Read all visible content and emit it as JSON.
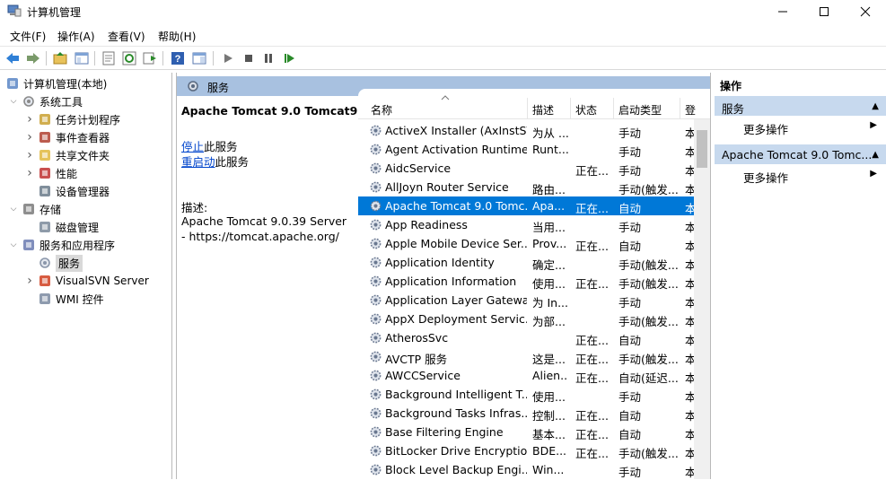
{
  "window": {
    "title": "计算机管理"
  },
  "menu": [
    "文件(F)",
    "操作(A)",
    "查看(V)",
    "帮助(H)"
  ],
  "tree": [
    {
      "label": "计算机管理(本地)",
      "level": 0,
      "expander": "",
      "icon": "computer-management-icon"
    },
    {
      "label": "系统工具",
      "level": 1,
      "expander": "v",
      "icon": "tools-icon"
    },
    {
      "label": "任务计划程序",
      "level": 2,
      "expander": ">",
      "icon": "task-scheduler-icon"
    },
    {
      "label": "事件查看器",
      "level": 2,
      "expander": ">",
      "icon": "event-viewer-icon"
    },
    {
      "label": "共享文件夹",
      "level": 2,
      "expander": ">",
      "icon": "shared-folder-icon"
    },
    {
      "label": "性能",
      "level": 2,
      "expander": ">",
      "icon": "performance-icon"
    },
    {
      "label": "设备管理器",
      "level": 2,
      "expander": "",
      "icon": "device-manager-icon"
    },
    {
      "label": "存储",
      "level": 1,
      "expander": "v",
      "icon": "storage-icon"
    },
    {
      "label": "磁盘管理",
      "level": 2,
      "expander": "",
      "icon": "disk-management-icon"
    },
    {
      "label": "服务和应用程序",
      "level": 1,
      "expander": "v",
      "icon": "services-apps-icon"
    },
    {
      "label": "服务",
      "level": 2,
      "expander": "",
      "icon": "services-icon",
      "selected": true
    },
    {
      "label": "VisualSVN Server",
      "level": 2,
      "expander": ">",
      "icon": "visualsvn-icon"
    },
    {
      "label": "WMI 控件",
      "level": 2,
      "expander": "",
      "icon": "wmi-icon"
    }
  ],
  "middle": {
    "header": "服务",
    "selected_service": "Apache Tomcat 9.0 Tomcat9",
    "stop_link": "停止",
    "stop_suffix": "此服务",
    "restart_link": "重启动",
    "restart_suffix": "此服务",
    "desc_label": "描述:",
    "desc_text": "Apache Tomcat 9.0.39 Server - https://tomcat.apache.org/"
  },
  "columns": [
    "名称",
    "描述",
    "状态",
    "启动类型",
    "登"
  ],
  "services": [
    {
      "name": "ActiveX Installer (AxInstSV)",
      "desc": "为从 ...",
      "status": "",
      "startup": "手动",
      "logon": "本"
    },
    {
      "name": "Agent Activation Runtime...",
      "desc": "Runt...",
      "status": "",
      "startup": "手动",
      "logon": "本"
    },
    {
      "name": "AidcService",
      "desc": "",
      "status": "正在...",
      "startup": "手动",
      "logon": "本"
    },
    {
      "name": "AllJoyn Router Service",
      "desc": "路由...",
      "status": "",
      "startup": "手动(触发...",
      "logon": "本"
    },
    {
      "name": "Apache Tomcat 9.0 Tomc...",
      "desc": "Apa...",
      "status": "正在...",
      "startup": "自动",
      "logon": "本",
      "selected": true
    },
    {
      "name": "App Readiness",
      "desc": "当用...",
      "status": "",
      "startup": "手动",
      "logon": "本"
    },
    {
      "name": "Apple Mobile Device Ser...",
      "desc": "Prov...",
      "status": "正在...",
      "startup": "自动",
      "logon": "本"
    },
    {
      "name": "Application Identity",
      "desc": "确定...",
      "status": "",
      "startup": "手动(触发...",
      "logon": "本"
    },
    {
      "name": "Application Information",
      "desc": "使用...",
      "status": "正在...",
      "startup": "手动(触发...",
      "logon": "本"
    },
    {
      "name": "Application Layer Gatewa...",
      "desc": "为 In...",
      "status": "",
      "startup": "手动",
      "logon": "本"
    },
    {
      "name": "AppX Deployment Servic...",
      "desc": "为部...",
      "status": "",
      "startup": "手动(触发...",
      "logon": "本"
    },
    {
      "name": "AtherosSvc",
      "desc": "",
      "status": "正在...",
      "startup": "自动",
      "logon": "本"
    },
    {
      "name": "AVCTP 服务",
      "desc": "这是...",
      "status": "正在...",
      "startup": "手动(触发...",
      "logon": "本"
    },
    {
      "name": "AWCCService",
      "desc": "Alien...",
      "status": "正在...",
      "startup": "自动(延迟...",
      "logon": "本"
    },
    {
      "name": "Background Intelligent T...",
      "desc": "使用...",
      "status": "",
      "startup": "手动",
      "logon": "本"
    },
    {
      "name": "Background Tasks Infras...",
      "desc": "控制...",
      "status": "正在...",
      "startup": "自动",
      "logon": "本"
    },
    {
      "name": "Base Filtering Engine",
      "desc": "基本...",
      "status": "正在...",
      "startup": "自动",
      "logon": "本"
    },
    {
      "name": "BitLocker Drive Encryptio...",
      "desc": "BDE...",
      "status": "正在...",
      "startup": "手动(触发...",
      "logon": "本"
    },
    {
      "name": "Block Level Backup Engi...",
      "desc": "Win...",
      "status": "",
      "startup": "手动",
      "logon": "本"
    }
  ],
  "actions": {
    "title": "操作",
    "section1": "服务",
    "more1": "更多操作",
    "section2": "Apache Tomcat 9.0 Tomc...",
    "more2": "更多操作"
  },
  "colors": {
    "selection": "#0078d7",
    "header_band": "#a8c1e0",
    "action_section": "#c7d9ee",
    "link": "#0044cc"
  }
}
